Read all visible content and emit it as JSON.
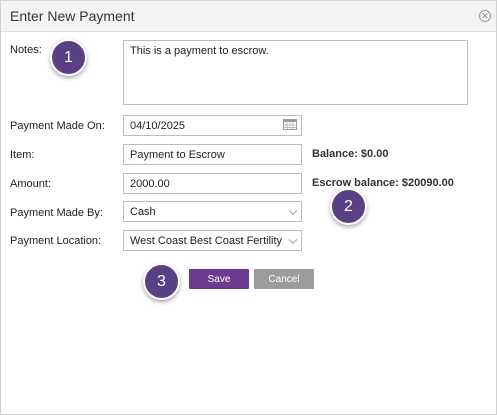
{
  "dialog": {
    "title": "Enter New Payment",
    "close_icon": "close-circle-icon"
  },
  "form": {
    "notes_label": "Notes:",
    "notes_value": "This is a payment to escrow.",
    "payment_made_on_label": "Payment Made On:",
    "payment_made_on_value": "04/10/2025",
    "item_label": "Item:",
    "item_value": "Payment to Escrow",
    "amount_label": "Amount:",
    "amount_value": "2000.00",
    "payment_made_by_label": "Payment Made By:",
    "payment_made_by_value": "Cash",
    "payment_location_label": "Payment Location:",
    "payment_location_value": "West Coast Best Coast Fertility"
  },
  "info": {
    "balance": "Balance: $0.00",
    "escrow_balance": "Escrow balance: $20090.00"
  },
  "buttons": {
    "save": "Save",
    "cancel": "Cancel"
  },
  "markers": {
    "m1": "1",
    "m2": "2",
    "m3": "3"
  },
  "colors": {
    "save_button": "#6c3a8e",
    "cancel_button": "#9b9b9b",
    "marker": "#5b3f84"
  }
}
